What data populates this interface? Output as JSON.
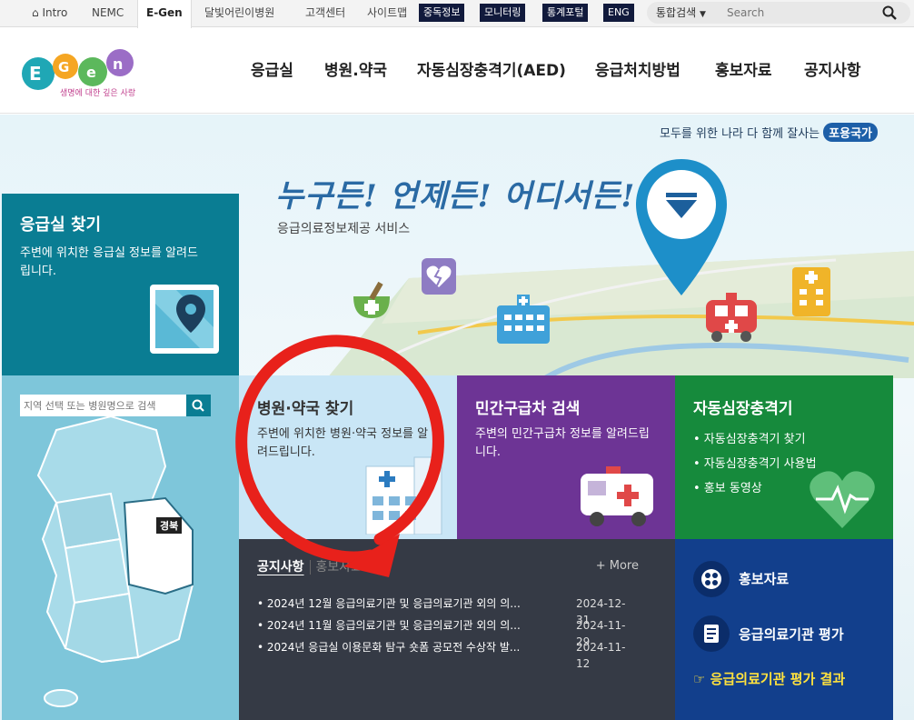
{
  "topbar": {
    "intro": "Intro",
    "nemc": "NEMC",
    "egen": "E-Gen",
    "child_hospital": "달빛어린이병원",
    "customer_center": "고객센터",
    "sitemap": "사이트맵",
    "poison_info": "중독정보",
    "monitoring": "모니터링",
    "stats_portal": "통계포털",
    "eng": "ENG",
    "search_scope": "통합검색",
    "search_placeholder": "Search"
  },
  "logo": {
    "text": "E-Gen",
    "tagline": "생명에 대한 깊은 사랑"
  },
  "nav": {
    "items": [
      "응급실",
      "병원.약국",
      "자동심장충격기(AED)",
      "응급처치방법",
      "홍보자료",
      "공지사항"
    ]
  },
  "hero": {
    "slogan": "모두를 위한 나라 다 함께 잘사는",
    "slogan_pill": "포용국가",
    "title": "누구든! 언제든! 어디서든!",
    "subtitle": "응급의료정보제공 서비스"
  },
  "er_panel": {
    "title": "응급실 찾기",
    "desc": "주변에 위치한 응급실 정보를 알려드립니다.",
    "search_placeholder": "지역 선택 또는 병원명으로 검색",
    "map_label": "경북"
  },
  "tiles": {
    "hospital": {
      "title": "병원·약국 찾기",
      "desc": "주변에 위치한 병원·약국 정보를 알려드립니다."
    },
    "ambulance": {
      "title": "민간구급차 검색",
      "desc": "주변의 민간구급차 정보를 알려드립니다."
    },
    "aed": {
      "title": "자동심장충격기",
      "items": [
        "• 자동심장충격기 찾기",
        "• 자동심장충격기 사용법",
        "• 홍보 동영상"
      ]
    }
  },
  "notice": {
    "tab_active": "공지사항",
    "tab_inactive": "홍보자료",
    "more": "+ More",
    "rows": [
      {
        "title": "• 2024년 12월 응급의료기관 및 응급의료기관 외의 의...",
        "date": "2024-12-31"
      },
      {
        "title": "• 2024년 11월 응급의료기관 및 응급의료기관 외의 의...",
        "date": "2024-11-29"
      },
      {
        "title": "• 2024년 응급실 이용문화 탐구 숏폼 공모전 수상작 발...",
        "date": "2024-11-12"
      }
    ]
  },
  "pr_panel": {
    "promo": "홍보자료",
    "evaluation": "응급의료기관 평가",
    "evaluation_result": "☞ 응급의료기관 평가 결과"
  }
}
